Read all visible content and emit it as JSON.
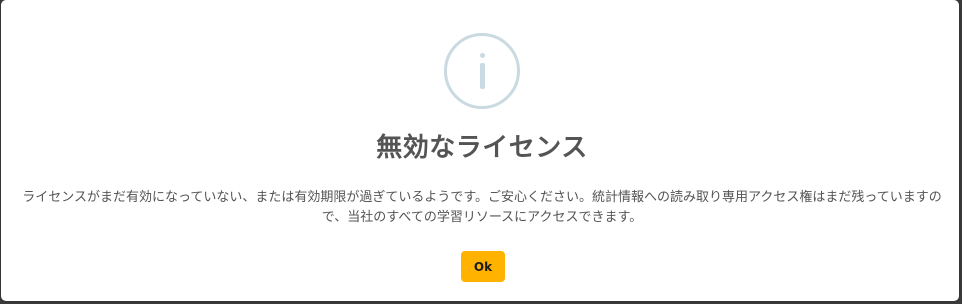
{
  "dialog": {
    "icon": "info-icon",
    "title": "無効なライセンス",
    "message": "ライセンスがまだ有効になっていない、または有効期限が過ぎているようです。ご安心ください。統計情報への読み取り専用アクセス権はまだ残っていますので、当社のすべての学習リソースにアクセスできます。",
    "ok_label": "Ok"
  },
  "colors": {
    "icon": "#c9dae1",
    "title": "#545454",
    "button": "#ffb300"
  }
}
